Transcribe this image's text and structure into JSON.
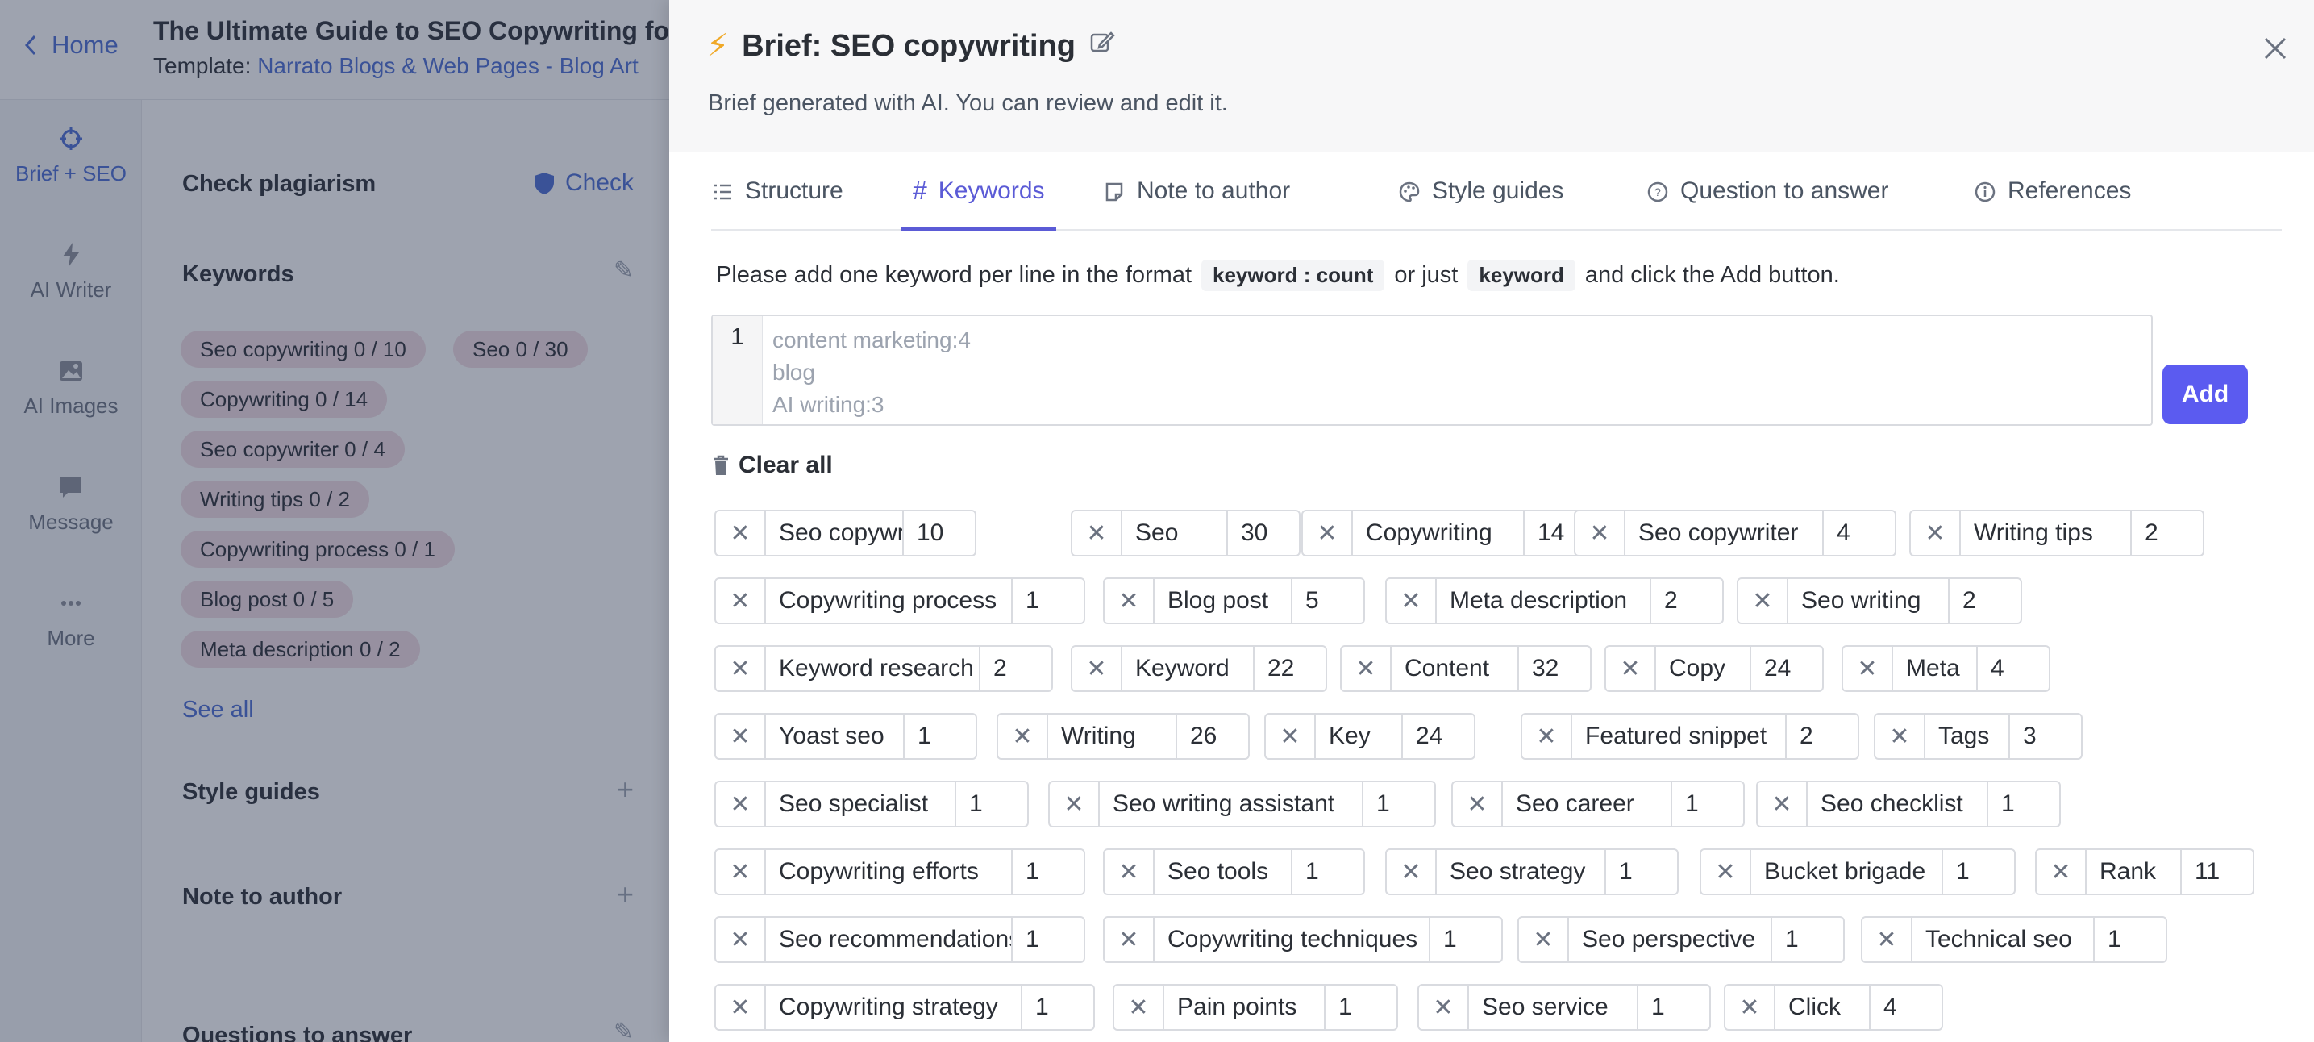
{
  "header": {
    "home_label": "Home",
    "doc_title": "The Ultimate Guide to SEO Copywriting for",
    "template_label": "Template:",
    "template_name": "Narrato Blogs & Web Pages - Blog Art"
  },
  "rail": [
    {
      "label": "Brief + SEO",
      "icon": "crosshair-icon"
    },
    {
      "label": "AI Writer",
      "icon": "bolt-icon"
    },
    {
      "label": "AI Images",
      "icon": "image-icon"
    },
    {
      "label": "Message",
      "icon": "chat-icon"
    },
    {
      "label": "More",
      "icon": "more-dots-icon"
    }
  ],
  "panel": {
    "plagiarism_label": "Check plagiarism",
    "check_label": "Check",
    "keywords_label": "Keywords",
    "chips": [
      "Seo copywriting   0 / 10",
      "Seo   0 / 30",
      "Copywriting   0 / 14",
      "Seo copywriter   0 / 4",
      "Writing tips   0 / 2",
      "Copywriting process   0 / 1",
      "Blog post   0 / 5",
      "Meta description   0 / 2"
    ],
    "see_all": "See all",
    "style_guides": "Style guides",
    "note_to_author": "Note to author",
    "questions_to_answer": "Questions to answer"
  },
  "drawer": {
    "title": "Brief: SEO copywriting",
    "subtitle": "Brief generated with AI. You can review and edit it.",
    "tabs": [
      "Structure",
      "Keywords",
      "Note to author",
      "Style guides",
      "Question to answer",
      "References"
    ],
    "active_tab": "Keywords",
    "hint_before": "Please add one keyword per line in the format",
    "hint_code1": "keyword : count",
    "hint_middle": "or just",
    "hint_code2": "keyword",
    "hint_after": "and click the Add button.",
    "line_number": "1",
    "placeholder": "content marketing:4\nblog\nAI writing:3",
    "add_label": "Add",
    "clear_all": "Clear all",
    "keywords": [
      {
        "name": "Seo copywriting",
        "count": "10"
      },
      {
        "name": "Seo",
        "count": "30"
      },
      {
        "name": "Copywriting",
        "count": "14"
      },
      {
        "name": "Seo copywriter",
        "count": "4"
      },
      {
        "name": "Writing tips",
        "count": "2"
      },
      {
        "name": "Copywriting process",
        "count": "1"
      },
      {
        "name": "Blog post",
        "count": "5"
      },
      {
        "name": "Meta description",
        "count": "2"
      },
      {
        "name": "Seo writing",
        "count": "2"
      },
      {
        "name": "Keyword research",
        "count": "2"
      },
      {
        "name": "Keyword",
        "count": "22"
      },
      {
        "name": "Content",
        "count": "32"
      },
      {
        "name": "Copy",
        "count": "24"
      },
      {
        "name": "Meta",
        "count": "4"
      },
      {
        "name": "Yoast seo",
        "count": "1"
      },
      {
        "name": "Writing",
        "count": "26"
      },
      {
        "name": "Key",
        "count": "24"
      },
      {
        "name": "Featured snippet",
        "count": "2"
      },
      {
        "name": "Tags",
        "count": "3"
      },
      {
        "name": "Seo specialist",
        "count": "1"
      },
      {
        "name": "Seo writing assistant",
        "count": "1"
      },
      {
        "name": "Seo career",
        "count": "1"
      },
      {
        "name": "Seo checklist",
        "count": "1"
      },
      {
        "name": "Copywriting efforts",
        "count": "1"
      },
      {
        "name": "Seo tools",
        "count": "1"
      },
      {
        "name": "Seo strategy",
        "count": "1"
      },
      {
        "name": "Bucket brigade",
        "count": "1"
      },
      {
        "name": "Rank",
        "count": "11"
      },
      {
        "name": "Seo recommendations",
        "count": "1"
      },
      {
        "name": "Copywriting techniques",
        "count": "1"
      },
      {
        "name": "Seo perspective",
        "count": "1"
      },
      {
        "name": "Technical seo",
        "count": "1"
      },
      {
        "name": "Copywriting strategy",
        "count": "1"
      },
      {
        "name": "Pain points",
        "count": "1"
      },
      {
        "name": "Seo service",
        "count": "1"
      },
      {
        "name": "Click",
        "count": "4"
      }
    ]
  },
  "colors": {
    "accent": "#5b5bd6",
    "add_button": "#5b5bf0",
    "bolt": "#f0a928",
    "link": "#4a6cd4"
  }
}
